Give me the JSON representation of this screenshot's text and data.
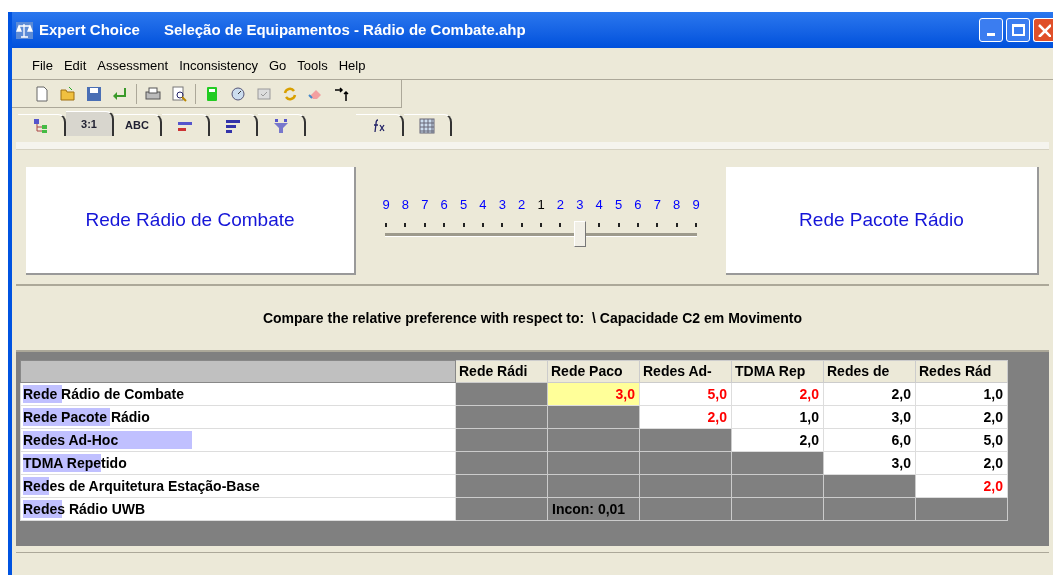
{
  "window": {
    "app": "Expert Choice",
    "title": "Seleção de Equipamentos - Rádio de Combate.ahp"
  },
  "menu": [
    {
      "label": "File"
    },
    {
      "label": "Edit"
    },
    {
      "label": "Assessment"
    },
    {
      "label": "Inconsistency"
    },
    {
      "label": "Go"
    },
    {
      "label": "Tools"
    },
    {
      "label": "Help"
    }
  ],
  "tabs": [
    {
      "kind": "tree",
      "selected": false
    },
    {
      "kind": "text",
      "label": "3:1",
      "selected": true
    },
    {
      "kind": "text",
      "label": "ABC",
      "selected": false
    },
    {
      "kind": "bars",
      "selected": false
    },
    {
      "kind": "sort",
      "selected": false
    },
    {
      "kind": "funnel",
      "selected": false
    },
    {
      "kind": "formula",
      "selected": false
    },
    {
      "kind": "grid",
      "selected": false
    }
  ],
  "comparison": {
    "left": "Rede Rádio de Combate",
    "right": "Rede Pacote Rádio",
    "scale": [
      {
        "label": "9",
        "color": "#0000ff"
      },
      {
        "label": "8",
        "color": "#0000ff"
      },
      {
        "label": "7",
        "color": "#0000ff"
      },
      {
        "label": "6",
        "color": "#0000ff"
      },
      {
        "label": "5",
        "color": "#0000ff"
      },
      {
        "label": "4",
        "color": "#0000ff"
      },
      {
        "label": "3",
        "color": "#0000ff"
      },
      {
        "label": "2",
        "color": "#0000ff"
      },
      {
        "label": "1",
        "color": "#000000"
      },
      {
        "label": "2",
        "color": "#0000ff"
      },
      {
        "label": "3",
        "color": "#0000ff"
      },
      {
        "label": "4",
        "color": "#0000ff"
      },
      {
        "label": "5",
        "color": "#0000ff"
      },
      {
        "label": "6",
        "color": "#0000ff"
      },
      {
        "label": "7",
        "color": "#0000ff"
      },
      {
        "label": "8",
        "color": "#0000ff"
      },
      {
        "label": "9",
        "color": "#0000ff"
      }
    ],
    "slider": {
      "level": 0.625
    },
    "prompt": "Compare the relative preference with respect to:  \\ Capacidade C2 em Movimento"
  },
  "table": {
    "columns": [
      "Rede Rádi",
      "Rede Paco",
      "Redes Ad-",
      "TDMA Rep",
      "Redes de",
      "Redes Rád"
    ],
    "rows": [
      {
        "name": "Rede Rádio de Combate",
        "level": 0.09,
        "cells": [
          {
            "kind": "empty"
          },
          {
            "kind": "value",
            "text": "3,0",
            "inverted": true,
            "selected": true
          },
          {
            "kind": "value",
            "text": "5,0",
            "inverted": true,
            "selected": false
          },
          {
            "kind": "value",
            "text": "2,0",
            "inverted": true,
            "selected": false
          },
          {
            "kind": "value",
            "text": "2,0",
            "inverted": false,
            "selected": false
          },
          {
            "kind": "value",
            "text": "1,0",
            "inverted": false,
            "selected": false
          }
        ]
      },
      {
        "name": "Rede Pacote Rádio",
        "level": 0.2,
        "cells": [
          {
            "kind": "empty"
          },
          {
            "kind": "empty"
          },
          {
            "kind": "value",
            "text": "2,0",
            "inverted": true,
            "selected": false
          },
          {
            "kind": "value",
            "text": "1,0",
            "inverted": false,
            "selected": false
          },
          {
            "kind": "value",
            "text": "3,0",
            "inverted": false,
            "selected": false
          },
          {
            "kind": "value",
            "text": "2,0",
            "inverted": false,
            "selected": false
          }
        ]
      },
      {
        "name": "Redes Ad-Hoc",
        "level": 0.39,
        "cells": [
          {
            "kind": "empty"
          },
          {
            "kind": "empty"
          },
          {
            "kind": "empty"
          },
          {
            "kind": "value",
            "text": "2,0",
            "inverted": false,
            "selected": false
          },
          {
            "kind": "value",
            "text": "6,0",
            "inverted": false,
            "selected": false
          },
          {
            "kind": "value",
            "text": "5,0",
            "inverted": false,
            "selected": false
          }
        ]
      },
      {
        "name": "TDMA Repetido",
        "level": 0.18,
        "cells": [
          {
            "kind": "empty"
          },
          {
            "kind": "empty"
          },
          {
            "kind": "empty"
          },
          {
            "kind": "empty"
          },
          {
            "kind": "value",
            "text": "3,0",
            "inverted": false,
            "selected": false
          },
          {
            "kind": "value",
            "text": "2,0",
            "inverted": false,
            "selected": false
          }
        ]
      },
      {
        "name": "Redes de Arquitetura Estação-Base",
        "level": 0.06,
        "cells": [
          {
            "kind": "empty"
          },
          {
            "kind": "empty"
          },
          {
            "kind": "empty"
          },
          {
            "kind": "empty"
          },
          {
            "kind": "empty"
          },
          {
            "kind": "value",
            "text": "2,0",
            "inverted": true,
            "selected": false
          }
        ]
      },
      {
        "name": "Redes Rádio UWB",
        "level": 0.09,
        "cells": [
          {
            "kind": "empty"
          },
          {
            "kind": "note",
            "text": "Incon: 0,01"
          },
          {
            "kind": "empty"
          },
          {
            "kind": "empty"
          },
          {
            "kind": "empty"
          },
          {
            "kind": "empty"
          }
        ]
      }
    ]
  }
}
